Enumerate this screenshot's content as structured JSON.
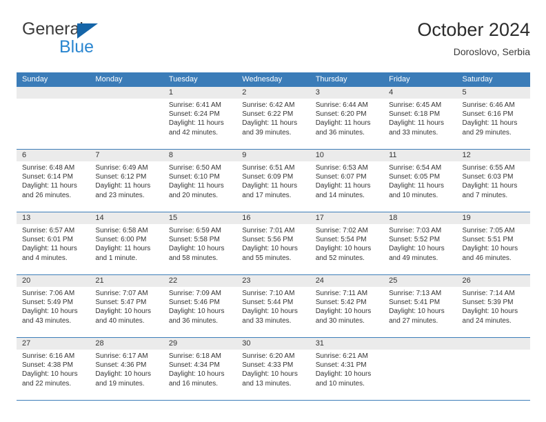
{
  "brand": {
    "name_part1": "General",
    "name_part2": "Blue",
    "logo_color": "#1565a8",
    "blue_text_color": "#2a86d0"
  },
  "header": {
    "title": "October 2024",
    "subtitle": "Doroslovo, Serbia"
  },
  "theme": {
    "header_row_color": "#3b7cb8",
    "day_number_bg": "#ebebeb",
    "grid_line_color": "#3b7cb8",
    "text_color": "#333333"
  },
  "weekdays": [
    "Sunday",
    "Monday",
    "Tuesday",
    "Wednesday",
    "Thursday",
    "Friday",
    "Saturday"
  ],
  "weeks": [
    [
      {
        "day": "",
        "sunrise": "",
        "sunset": "",
        "daylight_line1": "",
        "daylight_line2": "",
        "empty": true
      },
      {
        "day": "",
        "sunrise": "",
        "sunset": "",
        "daylight_line1": "",
        "daylight_line2": "",
        "empty": true
      },
      {
        "day": "1",
        "sunrise": "Sunrise: 6:41 AM",
        "sunset": "Sunset: 6:24 PM",
        "daylight_line1": "Daylight: 11 hours",
        "daylight_line2": "and 42 minutes."
      },
      {
        "day": "2",
        "sunrise": "Sunrise: 6:42 AM",
        "sunset": "Sunset: 6:22 PM",
        "daylight_line1": "Daylight: 11 hours",
        "daylight_line2": "and 39 minutes."
      },
      {
        "day": "3",
        "sunrise": "Sunrise: 6:44 AM",
        "sunset": "Sunset: 6:20 PM",
        "daylight_line1": "Daylight: 11 hours",
        "daylight_line2": "and 36 minutes."
      },
      {
        "day": "4",
        "sunrise": "Sunrise: 6:45 AM",
        "sunset": "Sunset: 6:18 PM",
        "daylight_line1": "Daylight: 11 hours",
        "daylight_line2": "and 33 minutes."
      },
      {
        "day": "5",
        "sunrise": "Sunrise: 6:46 AM",
        "sunset": "Sunset: 6:16 PM",
        "daylight_line1": "Daylight: 11 hours",
        "daylight_line2": "and 29 minutes."
      }
    ],
    [
      {
        "day": "6",
        "sunrise": "Sunrise: 6:48 AM",
        "sunset": "Sunset: 6:14 PM",
        "daylight_line1": "Daylight: 11 hours",
        "daylight_line2": "and 26 minutes."
      },
      {
        "day": "7",
        "sunrise": "Sunrise: 6:49 AM",
        "sunset": "Sunset: 6:12 PM",
        "daylight_line1": "Daylight: 11 hours",
        "daylight_line2": "and 23 minutes."
      },
      {
        "day": "8",
        "sunrise": "Sunrise: 6:50 AM",
        "sunset": "Sunset: 6:10 PM",
        "daylight_line1": "Daylight: 11 hours",
        "daylight_line2": "and 20 minutes."
      },
      {
        "day": "9",
        "sunrise": "Sunrise: 6:51 AM",
        "sunset": "Sunset: 6:09 PM",
        "daylight_line1": "Daylight: 11 hours",
        "daylight_line2": "and 17 minutes."
      },
      {
        "day": "10",
        "sunrise": "Sunrise: 6:53 AM",
        "sunset": "Sunset: 6:07 PM",
        "daylight_line1": "Daylight: 11 hours",
        "daylight_line2": "and 14 minutes."
      },
      {
        "day": "11",
        "sunrise": "Sunrise: 6:54 AM",
        "sunset": "Sunset: 6:05 PM",
        "daylight_line1": "Daylight: 11 hours",
        "daylight_line2": "and 10 minutes."
      },
      {
        "day": "12",
        "sunrise": "Sunrise: 6:55 AM",
        "sunset": "Sunset: 6:03 PM",
        "daylight_line1": "Daylight: 11 hours",
        "daylight_line2": "and 7 minutes."
      }
    ],
    [
      {
        "day": "13",
        "sunrise": "Sunrise: 6:57 AM",
        "sunset": "Sunset: 6:01 PM",
        "daylight_line1": "Daylight: 11 hours",
        "daylight_line2": "and 4 minutes."
      },
      {
        "day": "14",
        "sunrise": "Sunrise: 6:58 AM",
        "sunset": "Sunset: 6:00 PM",
        "daylight_line1": "Daylight: 11 hours",
        "daylight_line2": "and 1 minute."
      },
      {
        "day": "15",
        "sunrise": "Sunrise: 6:59 AM",
        "sunset": "Sunset: 5:58 PM",
        "daylight_line1": "Daylight: 10 hours",
        "daylight_line2": "and 58 minutes."
      },
      {
        "day": "16",
        "sunrise": "Sunrise: 7:01 AM",
        "sunset": "Sunset: 5:56 PM",
        "daylight_line1": "Daylight: 10 hours",
        "daylight_line2": "and 55 minutes."
      },
      {
        "day": "17",
        "sunrise": "Sunrise: 7:02 AM",
        "sunset": "Sunset: 5:54 PM",
        "daylight_line1": "Daylight: 10 hours",
        "daylight_line2": "and 52 minutes."
      },
      {
        "day": "18",
        "sunrise": "Sunrise: 7:03 AM",
        "sunset": "Sunset: 5:52 PM",
        "daylight_line1": "Daylight: 10 hours",
        "daylight_line2": "and 49 minutes."
      },
      {
        "day": "19",
        "sunrise": "Sunrise: 7:05 AM",
        "sunset": "Sunset: 5:51 PM",
        "daylight_line1": "Daylight: 10 hours",
        "daylight_line2": "and 46 minutes."
      }
    ],
    [
      {
        "day": "20",
        "sunrise": "Sunrise: 7:06 AM",
        "sunset": "Sunset: 5:49 PM",
        "daylight_line1": "Daylight: 10 hours",
        "daylight_line2": "and 43 minutes."
      },
      {
        "day": "21",
        "sunrise": "Sunrise: 7:07 AM",
        "sunset": "Sunset: 5:47 PM",
        "daylight_line1": "Daylight: 10 hours",
        "daylight_line2": "and 40 minutes."
      },
      {
        "day": "22",
        "sunrise": "Sunrise: 7:09 AM",
        "sunset": "Sunset: 5:46 PM",
        "daylight_line1": "Daylight: 10 hours",
        "daylight_line2": "and 36 minutes."
      },
      {
        "day": "23",
        "sunrise": "Sunrise: 7:10 AM",
        "sunset": "Sunset: 5:44 PM",
        "daylight_line1": "Daylight: 10 hours",
        "daylight_line2": "and 33 minutes."
      },
      {
        "day": "24",
        "sunrise": "Sunrise: 7:11 AM",
        "sunset": "Sunset: 5:42 PM",
        "daylight_line1": "Daylight: 10 hours",
        "daylight_line2": "and 30 minutes."
      },
      {
        "day": "25",
        "sunrise": "Sunrise: 7:13 AM",
        "sunset": "Sunset: 5:41 PM",
        "daylight_line1": "Daylight: 10 hours",
        "daylight_line2": "and 27 minutes."
      },
      {
        "day": "26",
        "sunrise": "Sunrise: 7:14 AM",
        "sunset": "Sunset: 5:39 PM",
        "daylight_line1": "Daylight: 10 hours",
        "daylight_line2": "and 24 minutes."
      }
    ],
    [
      {
        "day": "27",
        "sunrise": "Sunrise: 6:16 AM",
        "sunset": "Sunset: 4:38 PM",
        "daylight_line1": "Daylight: 10 hours",
        "daylight_line2": "and 22 minutes."
      },
      {
        "day": "28",
        "sunrise": "Sunrise: 6:17 AM",
        "sunset": "Sunset: 4:36 PM",
        "daylight_line1": "Daylight: 10 hours",
        "daylight_line2": "and 19 minutes."
      },
      {
        "day": "29",
        "sunrise": "Sunrise: 6:18 AM",
        "sunset": "Sunset: 4:34 PM",
        "daylight_line1": "Daylight: 10 hours",
        "daylight_line2": "and 16 minutes."
      },
      {
        "day": "30",
        "sunrise": "Sunrise: 6:20 AM",
        "sunset": "Sunset: 4:33 PM",
        "daylight_line1": "Daylight: 10 hours",
        "daylight_line2": "and 13 minutes."
      },
      {
        "day": "31",
        "sunrise": "Sunrise: 6:21 AM",
        "sunset": "Sunset: 4:31 PM",
        "daylight_line1": "Daylight: 10 hours",
        "daylight_line2": "and 10 minutes."
      },
      {
        "day": "",
        "sunrise": "",
        "sunset": "",
        "daylight_line1": "",
        "daylight_line2": "",
        "empty": true
      },
      {
        "day": "",
        "sunrise": "",
        "sunset": "",
        "daylight_line1": "",
        "daylight_line2": "",
        "empty": true
      }
    ]
  ]
}
